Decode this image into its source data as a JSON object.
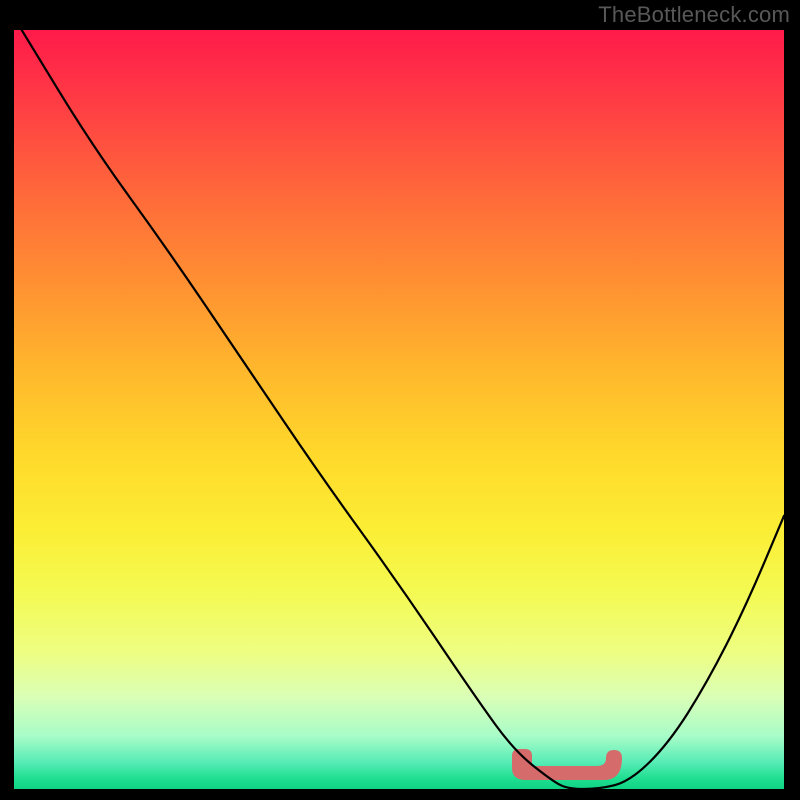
{
  "attribution": "TheBottleneck.com",
  "chart_data": {
    "type": "line",
    "title": "",
    "xlabel": "",
    "ylabel": "",
    "xlim": [
      0,
      100
    ],
    "ylim": [
      0,
      100
    ],
    "series": [
      {
        "name": "bottleneck-curve",
        "x": [
          1,
          10,
          20,
          30,
          40,
          50,
          60,
          65,
          70,
          72,
          76,
          80,
          85,
          90,
          95,
          100
        ],
        "y": [
          100,
          85,
          71,
          56,
          41,
          27,
          12,
          5,
          1,
          0,
          0,
          1,
          6,
          14,
          24,
          36
        ]
      }
    ],
    "annotations": [
      {
        "name": "flat-minimum-marker",
        "x_range": [
          64.5,
          77
        ],
        "y": 1.5,
        "color": "#d56b6b"
      }
    ]
  },
  "colors": {
    "curve": "#000000",
    "marker": "#d56b6b",
    "frame": "#000000",
    "attribution_text": "#585858"
  }
}
